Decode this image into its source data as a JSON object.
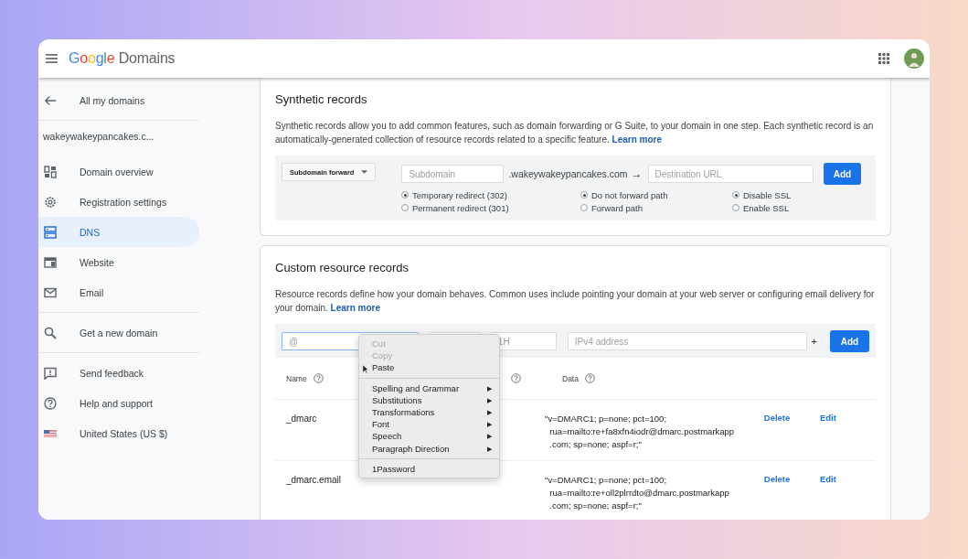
{
  "app": {
    "brand": "Google",
    "product": "Domains"
  },
  "sidebar": {
    "back": "All my domains",
    "domain": "wakeywakeypancakes.c...",
    "groups": [
      [
        {
          "label": "Domain overview",
          "selected": false
        },
        {
          "label": "Registration settings",
          "selected": false
        },
        {
          "label": "DNS",
          "selected": true
        },
        {
          "label": "Website",
          "selected": false
        },
        {
          "label": "Email",
          "selected": false
        }
      ],
      [
        {
          "label": "Get a new domain",
          "selected": false
        }
      ],
      [
        {
          "label": "Send feedback",
          "selected": false
        },
        {
          "label": "Help and support",
          "selected": false
        },
        {
          "label": "United States (US $)",
          "selected": false
        }
      ]
    ]
  },
  "synthetic": {
    "title": "Synthetic records",
    "description": "Synthetic records allow you to add common features, such as domain forwarding or G Suite, to your domain in one step. Each synthetic record is an automatically-generated collection of resource records related to a specific feature.",
    "link": "Learn more",
    "type": "Subdomain forward",
    "subdomain_placeholder": "Subdomain",
    "suffix": ".wakeywakeypancakes.com",
    "arrow": "→",
    "destination_placeholder": "Destination URL",
    "add": "Add",
    "radio_groups": [
      [
        {
          "label": "Temporary redirect (302)",
          "selected": true
        },
        {
          "label": "Permanent redirect (301)",
          "selected": false
        }
      ],
      [
        {
          "label": "Do not forward path",
          "selected": true
        },
        {
          "label": "Forward path",
          "selected": false
        }
      ],
      [
        {
          "label": "Disable SSL",
          "selected": true
        },
        {
          "label": "Enable SSL",
          "selected": false
        }
      ]
    ]
  },
  "custom": {
    "title": "Custom resource records",
    "description": "Resource records define how your domain behaves. Common uses include pointing your domain at your web server or configuring email delivery for your domain.",
    "link": "Learn more",
    "name_placeholder": "@",
    "ttl_placeholder": "1H",
    "data_placeholder": "IPv4 address",
    "plus": "+",
    "add": "Add",
    "columns": [
      {
        "label": "Name",
        "help": true
      },
      {
        "help": true
      },
      {
        "label": "Data",
        "help": true
      }
    ],
    "rows": [
      {
        "name": "_dmarc",
        "data": "\"v=DMARC1; p=none; pct=100;\n  rua=mailto:re+fa8xfn4iodr@dmarc.postmarkapp\n  .com; sp=none; aspf=r;\"",
        "delete": "Delete",
        "edit": "Edit"
      },
      {
        "name": "_dmarc.email",
        "data": "\"v=DMARC1; p=none; pct=100;\n  rua=mailto:re+oll2plrrdto@dmarc.postmarkapp\n  .com; sp=none; aspf=r;\"",
        "delete": "Delete",
        "edit": "Edit"
      }
    ]
  },
  "context_menu": [
    [
      {
        "label": "Cut",
        "disabled": true,
        "submenu": false
      },
      {
        "label": "Copy",
        "disabled": true,
        "submenu": false
      },
      {
        "label": "Paste",
        "disabled": false,
        "submenu": false
      }
    ],
    [
      {
        "label": "Spelling and Grammar",
        "disabled": false,
        "submenu": true
      },
      {
        "label": "Substitutions",
        "disabled": false,
        "submenu": true
      },
      {
        "label": "Transformations",
        "disabled": false,
        "submenu": true
      },
      {
        "label": "Font",
        "disabled": false,
        "submenu": true
      },
      {
        "label": "Speech",
        "disabled": false,
        "submenu": true
      },
      {
        "label": "Paragraph Direction",
        "disabled": false,
        "submenu": true
      }
    ],
    [
      {
        "label": "1Password",
        "disabled": false,
        "submenu": false
      }
    ]
  ],
  "submenu_marker": "▶"
}
